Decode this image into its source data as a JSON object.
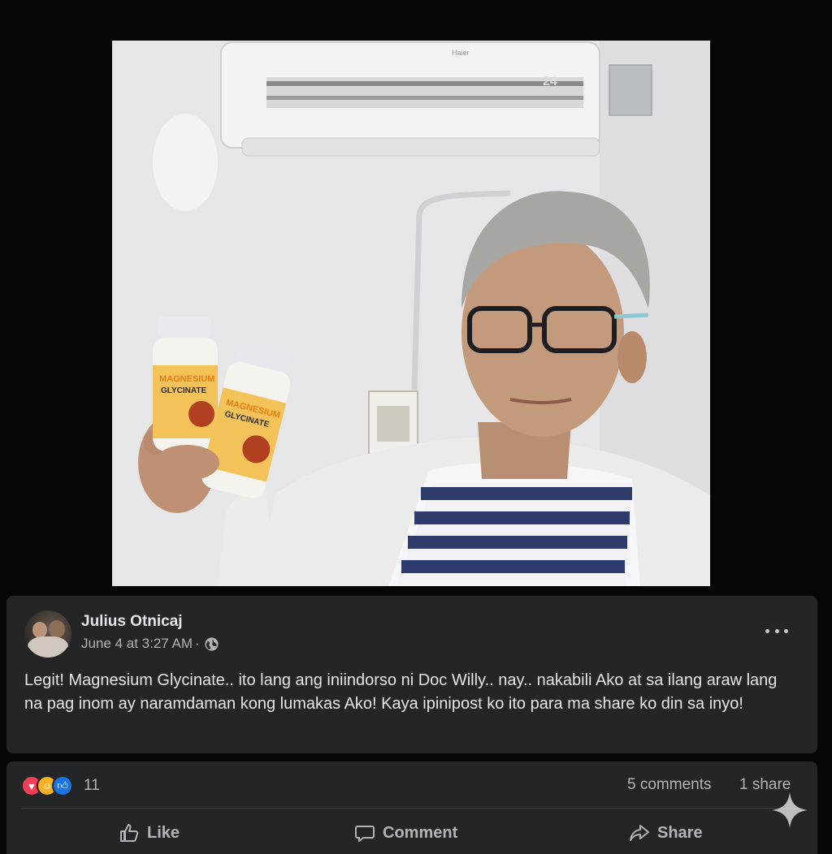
{
  "photo": {
    "alt_subject": "man-holding-supplement-bottles",
    "bottle_brand": "MAGNESIUM",
    "bottle_name": "GLYCINATE",
    "ac_display": "24"
  },
  "post": {
    "author": "Julius Otnicaj",
    "timestamp": "June 4 at 3:27 AM",
    "separator": "·",
    "privacy_icon": "globe-icon",
    "menu_icon": "more-horizontal-icon",
    "text": "Legit! Magnesium Glycinate.. ito lang ang iniindorso ni Doc Willy.. nay.. nakabili Ako at sa ilang araw lang na pag inom ay naramdaman kong lumakas Ako! Kaya ipinipost ko ito para ma share ko din sa inyo!"
  },
  "stats": {
    "reaction_icons": [
      "love-icon",
      "care-icon",
      "like-icon"
    ],
    "reaction_count": "11",
    "comments": "5 comments",
    "shares": "1 share"
  },
  "actions": {
    "like": "Like",
    "comment": "Comment",
    "share": "Share"
  },
  "colors": {
    "card_bg": "#242526",
    "text_primary": "#e4e6eb",
    "text_secondary": "#b0b3b8",
    "love": "#f33e58",
    "care": "#f7b125",
    "like": "#1b74e4"
  }
}
